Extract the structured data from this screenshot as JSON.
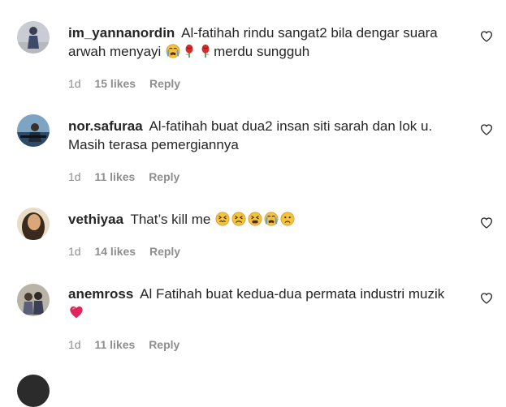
{
  "comments": [
    {
      "username": "im_yannanordin",
      "text_a": "Al-fatihah rindu sangat2 bila dengar suara arwah menyayi",
      "emojis_a": [
        "crying-face",
        "rose",
        "rose"
      ],
      "text_b": "merdu sungguh",
      "age": "1d",
      "likes": "15 likes",
      "reply": "Reply"
    },
    {
      "username": "nor.safuraa",
      "text_a": "Al-fatihah buat dua2 insan siti sarah dan lok u. Masih terasa pemergiannya",
      "emojis_a": [],
      "text_b": "",
      "age": "1d",
      "likes": "11 likes",
      "reply": "Reply"
    },
    {
      "username": "vethiyaa",
      "text_a": "That’s kill me",
      "emojis_a": [
        "confounded-face",
        "persevering-face",
        "tired-face",
        "crying-face",
        "frowning-face"
      ],
      "text_b": "",
      "age": "1d",
      "likes": "14 likes",
      "reply": "Reply"
    },
    {
      "username": "anemross",
      "text_a": "Al Fatihah buat kedua-dua permata industri muzik",
      "emojis_a": [
        "red-heart"
      ],
      "text_b": "",
      "age": "1d",
      "likes": "11 likes",
      "reply": "Reply"
    }
  ],
  "colors": {
    "text": "#262626",
    "meta": "#8e8e8e",
    "emoji_yellow": "#f5c33b",
    "heart_red": "#e0245e"
  }
}
